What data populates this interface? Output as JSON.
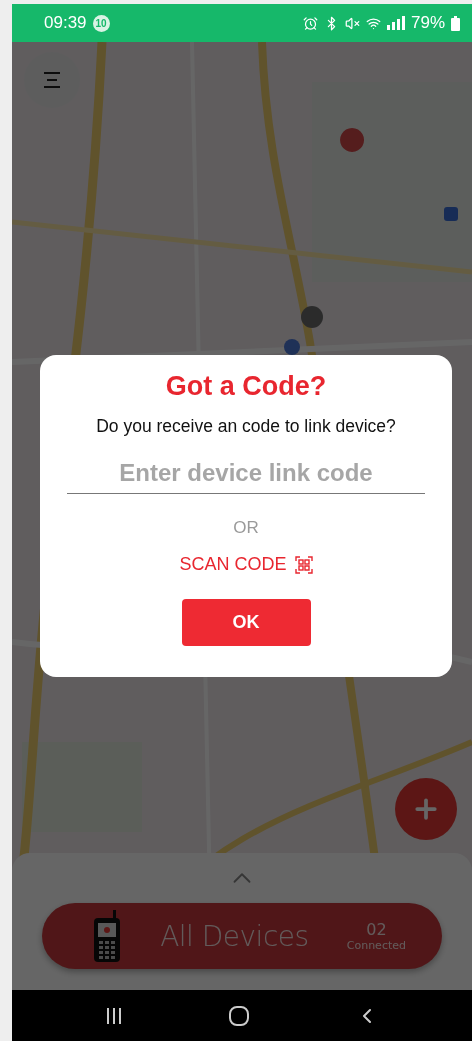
{
  "status_bar": {
    "time": "09:39",
    "notification_count": "10",
    "battery": "79%"
  },
  "dialog": {
    "title": "Got a Code?",
    "message": "Do you receive an code to link device?",
    "code_field": {
      "placeholder": "Enter device link code"
    },
    "separator": "OR",
    "scan_link": "SCAN CODE",
    "ok_button": "OK"
  },
  "device_bar": {
    "label": "All Devices",
    "count": "02",
    "count_label": "Connected"
  }
}
